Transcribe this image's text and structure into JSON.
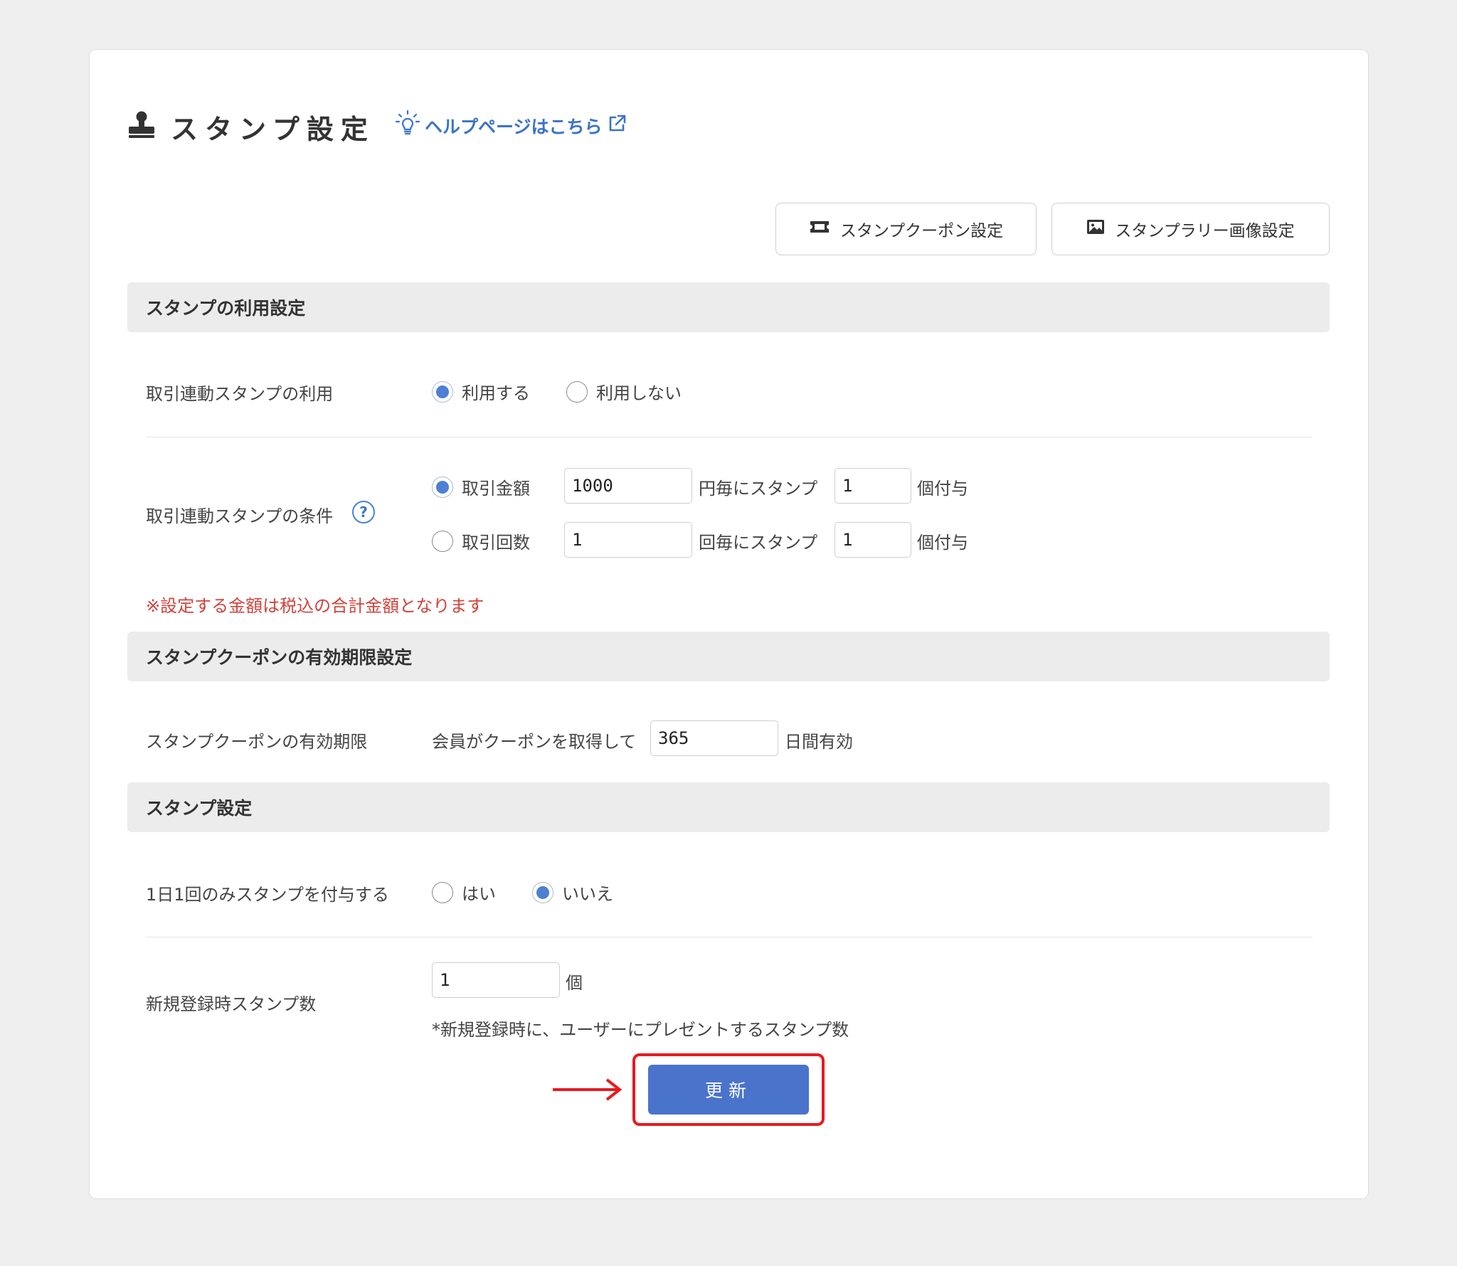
{
  "header": {
    "title": "スタンプ設定",
    "help_link": "ヘルプページはこちら"
  },
  "top_buttons": {
    "coupon": "スタンプクーポン設定",
    "rally_image": "スタンプラリー画像設定"
  },
  "section_usage": {
    "heading": "スタンプの利用設定",
    "usage_row": {
      "label": "取引連動スタンプの利用",
      "options": [
        "利用する",
        "利用しない"
      ],
      "selected": "利用する"
    },
    "condition_row": {
      "label": "取引連動スタンプの条件",
      "help_icon_text": "?",
      "amount": {
        "option": "取引金額",
        "value": "1000",
        "middle_text": "円毎にスタンプ",
        "count": "1",
        "suffix": "個付与",
        "selected": true
      },
      "times": {
        "option": "取引回数",
        "value": "1",
        "middle_text": "回毎にスタンプ",
        "count": "1",
        "suffix": "個付与",
        "selected": false
      }
    },
    "note": "※設定する金額は税込の合計金額となります"
  },
  "section_expiry": {
    "heading": "スタンプクーポンの有効期限設定",
    "row": {
      "label": "スタンプクーポンの有効期限",
      "prefix": "会員がクーポンを取得して",
      "value": "365",
      "suffix": "日間有効"
    }
  },
  "section_stamp": {
    "heading": "スタンプ設定",
    "once_row": {
      "label": "1日1回のみスタンプを付与する",
      "options": [
        "はい",
        "いいえ"
      ],
      "selected": "いいえ"
    },
    "signup_row": {
      "label": "新規登録時スタンプ数",
      "value": "1",
      "unit": "個",
      "hint": "*新規登録時に、ユーザーにプレゼントするスタンプ数"
    }
  },
  "submit": {
    "label": "更新"
  },
  "colors": {
    "accent": "#4a73cc",
    "link": "#3b73c7",
    "note_red": "#d0433c",
    "highlight_frame": "#e8191e"
  },
  "icons": {
    "title": "stamp-icon",
    "help": "lightbulb-icon",
    "external": "external-link-icon",
    "coupon": "ticket-icon",
    "image": "image-icon"
  }
}
